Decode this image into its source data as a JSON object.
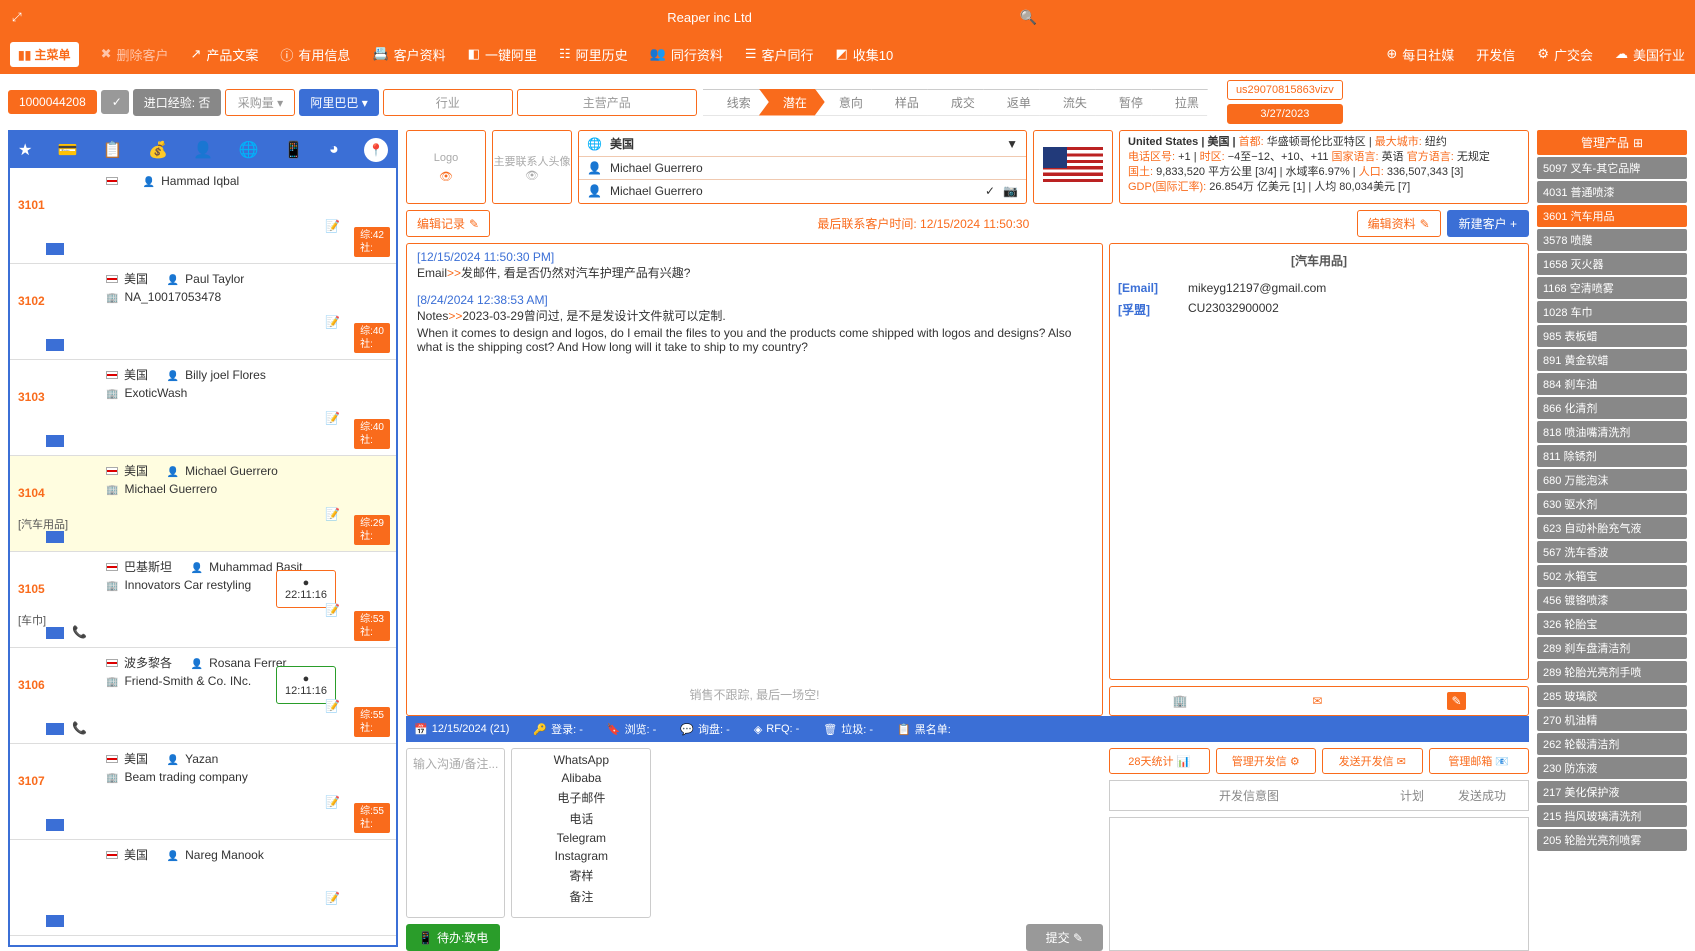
{
  "top": {
    "company": "Reaper inc Ltd",
    "expand_icon": "⤢",
    "search_icon": "🔍"
  },
  "menu": {
    "main": "主菜单",
    "items": [
      "删除客户",
      "产品文案",
      "有用信息",
      "客户资料",
      "一键阿里",
      "阿里历史",
      "同行资料",
      "客户同行",
      "收集10"
    ],
    "right": [
      "每日社媒",
      "开发信",
      "广交会",
      "美国行业"
    ]
  },
  "filters": {
    "code": "1000044208",
    "experience": "进口经验: 否",
    "purchase": "采购量",
    "source": "阿里巴巴",
    "industry": "行业",
    "main_product": "主营产品"
  },
  "pipeline": [
    "线索",
    "潜在",
    "意向",
    "样品",
    "成交",
    "返单",
    "流失",
    "暂停",
    "拉黑"
  ],
  "pipeline_active": 1,
  "right_chips": {
    "id": "us29070815863vizv",
    "date": "3/27/2023"
  },
  "left_entries": [
    {
      "idx": "3101",
      "country": "",
      "name": "Hammad Iqbal",
      "company": "",
      "stat": "综:42",
      "social": "社:"
    },
    {
      "idx": "3102",
      "country": "美国",
      "name": "Paul Taylor",
      "company": "NA_10017053478",
      "stat": "综:40",
      "social": "社:"
    },
    {
      "idx": "3103",
      "country": "美国",
      "name": "Billy joel Flores",
      "company": "ExoticWash",
      "stat": "综:40",
      "social": "社:"
    },
    {
      "idx": "3104",
      "country": "美国",
      "name": "Michael Guerrero",
      "company": "Michael Guerrero",
      "tag": "[汽车用品]",
      "stat": "综:29",
      "social": "社:",
      "active": true
    },
    {
      "idx": "3105",
      "country": "巴基斯坦",
      "name": "Muhammad Basit",
      "company": "Innovators Car restyling",
      "tag": "[车巾]",
      "stat": "综:53",
      "social": "社:",
      "timer": "22:11:16",
      "phone": true
    },
    {
      "idx": "3106",
      "country": "波多黎各",
      "name": "Rosana Ferrer",
      "company": "Friend-Smith & Co. INc.",
      "stat": "综:55",
      "social": "社:",
      "timer": "12:11:16",
      "timer_green": true,
      "phone": true
    },
    {
      "idx": "3107",
      "country": "美国",
      "name": "Yazan",
      "company": "Beam trading company",
      "stat": "综:55",
      "social": "社:"
    },
    {
      "idx": "",
      "country": "美国",
      "name": "Nareg Manook",
      "company": "",
      "stat": "",
      "social": ""
    }
  ],
  "center_top": {
    "logo": "Logo",
    "avatar": "主要联系人头像",
    "rows": [
      {
        "icon": "🌐",
        "text": "美国",
        "filter": true
      },
      {
        "icon": "👤",
        "text": "Michael Guerrero"
      },
      {
        "icon": "👤",
        "text": "Michael Guerrero",
        "check": true,
        "cam": true
      }
    ]
  },
  "country_info": {
    "line1a": "United States | 美国 | ",
    "line1k1": "首都:",
    "line1v1": " 华盛顿哥伦比亚特区 | ",
    "line1k2": "最大城市:",
    "line1v2": " 纽约",
    "line2k1": "电话区号:",
    "line2v1": " +1 | ",
    "line2k2": "时区:",
    "line2v2": " −4至−12、+10、+11 ",
    "line2k3": "国家语言:",
    "line2v3": " 英语 ",
    "line2k4": "官方语言:",
    "line2v4": " 无规定",
    "line3k1": "国土:",
    "line3v1": " 9,833,520 平方公里 [3/4] | 水域率6.97% | ",
    "line3k2": "人口:",
    "line3v2": " 336,507,343 [3]",
    "line4k1": "GDP(国际汇率):",
    "line4v1": " 26.854万 亿美元 [1] | 人均 80,034美元 [7]"
  },
  "actions": {
    "edit_record": "编辑记录",
    "last_contact": "最后联系客户时间: 12/15/2024 11:50:30",
    "edit_info": "编辑资料",
    "new_customer": "新建客户"
  },
  "notes": {
    "ts1": "[12/15/2024 11:50:30 PM]",
    "l1a": "Email",
    "l1b": ">>",
    "l1c": "发邮件, 看是否仍然对汽车护理产品有兴趣?",
    "ts2": "[8/24/2024 12:38:53 AM]",
    "l2a": "Notes",
    "l2b": ">>",
    "l2c": "2023-03-29曾问过, 是不是发设计文件就可以定制.",
    "l3": "When it comes to design and logos, do I email the files to you and the products come shipped with logos and designs? Also what is the shipping cost? And How long will it take to ship to my country?",
    "slogan": "销售不跟踪, 最后一场空!"
  },
  "info_panel": {
    "title": "[汽车用品]",
    "email_k": "[Email]",
    "email_v": "mikeyg12197@gmail.com",
    "fm_k": "[孚盟]",
    "fm_v": "CU23032900002"
  },
  "blue_strip": {
    "date": "12/15/2024 (21)",
    "login": "登录: -",
    "browse": "浏览: -",
    "inquiry": "询盘: -",
    "rfq": "RFQ: -",
    "spam": "垃圾: -",
    "blacklist": "黑名单:"
  },
  "compose": {
    "placeholder": "输入沟通/备注...",
    "channels": [
      "WhatsApp",
      "Alibaba",
      "电子邮件",
      "电话",
      "Telegram",
      "Instagram",
      "寄样",
      "备注"
    ],
    "todo": "待办:致电",
    "submit": "提交",
    "btns": [
      "28天统计",
      "管理开发信",
      "发送开发信",
      "管理邮箱"
    ],
    "stat_cols": [
      "开发信意图",
      "计划",
      "发送成功"
    ]
  },
  "products": {
    "header": "管理产品",
    "items": [
      {
        "t": "5097 叉车-其它品牌"
      },
      {
        "t": "4031 普通喷漆"
      },
      {
        "t": "3601 汽车用品",
        "active": true
      },
      {
        "t": "3578 喷膜"
      },
      {
        "t": "1658 灭火器"
      },
      {
        "t": "1168 空清喷雾"
      },
      {
        "t": "1028 车巾"
      },
      {
        "t": "985  表板蜡"
      },
      {
        "t": "891  黄金软蜡"
      },
      {
        "t": "884  刹车油"
      },
      {
        "t": "866  化清剂"
      },
      {
        "t": "818  喷油嘴清洗剂"
      },
      {
        "t": "811  除锈剂"
      },
      {
        "t": "680  万能泡沫"
      },
      {
        "t": "630  驱水剂"
      },
      {
        "t": "623  自动补胎充气液"
      },
      {
        "t": "567  洗车香波"
      },
      {
        "t": "502  水箱宝"
      },
      {
        "t": "456  镀铬喷漆"
      },
      {
        "t": "326  轮胎宝"
      },
      {
        "t": "289  刹车盘清洁剂"
      },
      {
        "t": "289  轮胎光亮剂手喷"
      },
      {
        "t": "285  玻璃胶"
      },
      {
        "t": "270  机油精"
      },
      {
        "t": "262  轮毂清洁剂"
      },
      {
        "t": "230  防冻液"
      },
      {
        "t": "217  美化保护液"
      },
      {
        "t": "215  挡风玻璃清洗剂"
      },
      {
        "t": "205  轮胎光亮剂喷雾"
      }
    ]
  }
}
